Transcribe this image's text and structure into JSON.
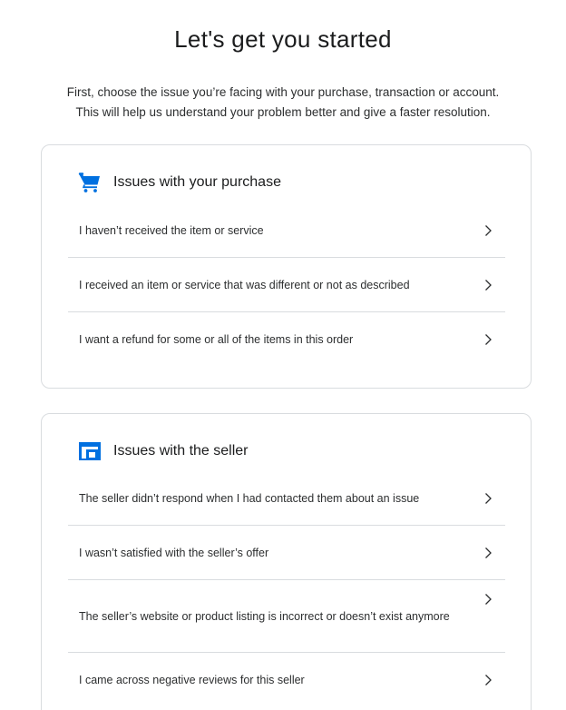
{
  "header": {
    "title": "Let's get you started",
    "intro_line1": "First, choose the issue you’re facing with your purchase, transaction or account.",
    "intro_line2": "This will help us understand your problem better and give a faster resolution."
  },
  "sections": [
    {
      "heading": "Issues with your purchase",
      "icon": "shopping-cart-icon",
      "items": [
        {
          "label": "I haven’t received the item or service"
        },
        {
          "label": "I received an item or service that was different or not as described"
        },
        {
          "label": "I want a refund for some or all of the items in this order"
        }
      ]
    },
    {
      "heading": "Issues with the seller",
      "icon": "storefront-icon",
      "items": [
        {
          "label": "The seller didn’t respond when I had contacted them about an issue"
        },
        {
          "label": "I wasn’t satisfied with the seller’s offer"
        },
        {
          "label": "The seller’s website or product listing is incorrect or doesn’t exist anymore"
        },
        {
          "label": "I came across negative reviews for this seller"
        }
      ]
    }
  ],
  "colors": {
    "icon_blue": "#0070e0",
    "text": "#2c2e2f",
    "divider": "#d9dcdf"
  }
}
